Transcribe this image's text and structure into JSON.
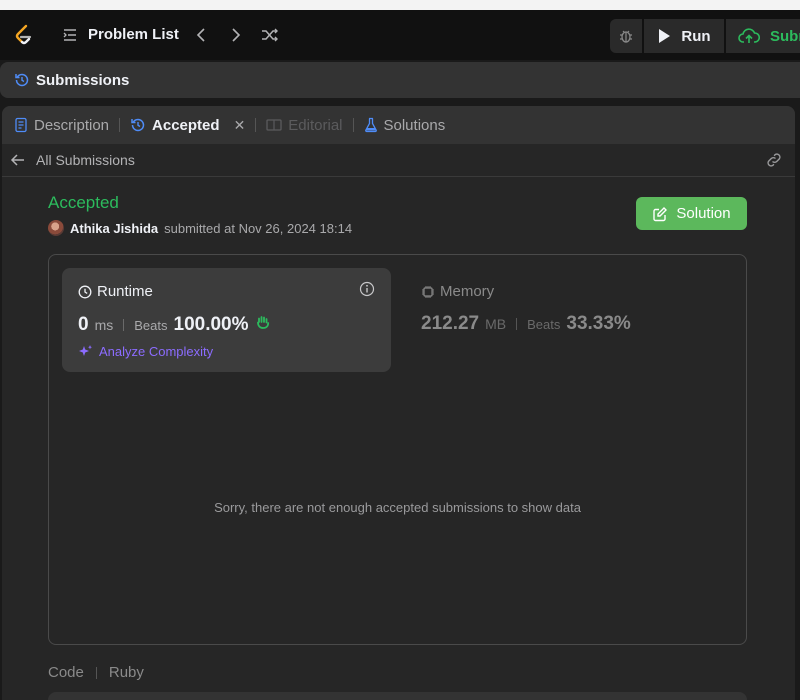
{
  "topbar": {
    "problem_list_label": "Problem List",
    "run_label": "Run",
    "submit_label": "Subr"
  },
  "submissions_panel": {
    "title": "Submissions"
  },
  "tabs": [
    {
      "label": "Description",
      "state": "normal"
    },
    {
      "label": "Accepted",
      "state": "active"
    },
    {
      "label": "Editorial",
      "state": "disabled"
    },
    {
      "label": "Solutions",
      "state": "normal"
    }
  ],
  "back_link": {
    "label": "All Submissions"
  },
  "submission": {
    "status": "Accepted",
    "user": "Athika Jishida",
    "submitted_text": "submitted at Nov 26, 2024 18:14",
    "solution_button": "Solution"
  },
  "runtime": {
    "title": "Runtime",
    "value": "0",
    "unit": "ms",
    "beats_label": "Beats",
    "beats_value": "100.00%",
    "analyze_label": "Analyze Complexity"
  },
  "memory": {
    "title": "Memory",
    "value": "212.27",
    "unit": "MB",
    "beats_label": "Beats",
    "beats_value": "33.33%"
  },
  "empty_message": "Sorry, there are not enough accepted submissions to show data",
  "code_section": {
    "label": "Code",
    "language": "Ruby"
  },
  "colors": {
    "accent_green": "#2cbb5d",
    "solution_button": "#5cb85c",
    "analyze_purple": "#8c6cff",
    "tab_blue": "#4f8cf7"
  },
  "icons": [
    "leetcode-logo-icon",
    "list-icon",
    "chevron-left-icon",
    "chevron-right-icon",
    "shuffle-icon",
    "bug-icon",
    "play-icon",
    "cloud-upload-icon",
    "history-icon",
    "description-icon",
    "close-icon",
    "book-icon",
    "flask-icon",
    "arrow-left-icon",
    "link-icon",
    "edit-icon",
    "clock-icon",
    "info-icon",
    "hand-icon",
    "sparkle-icon",
    "chip-icon"
  ]
}
